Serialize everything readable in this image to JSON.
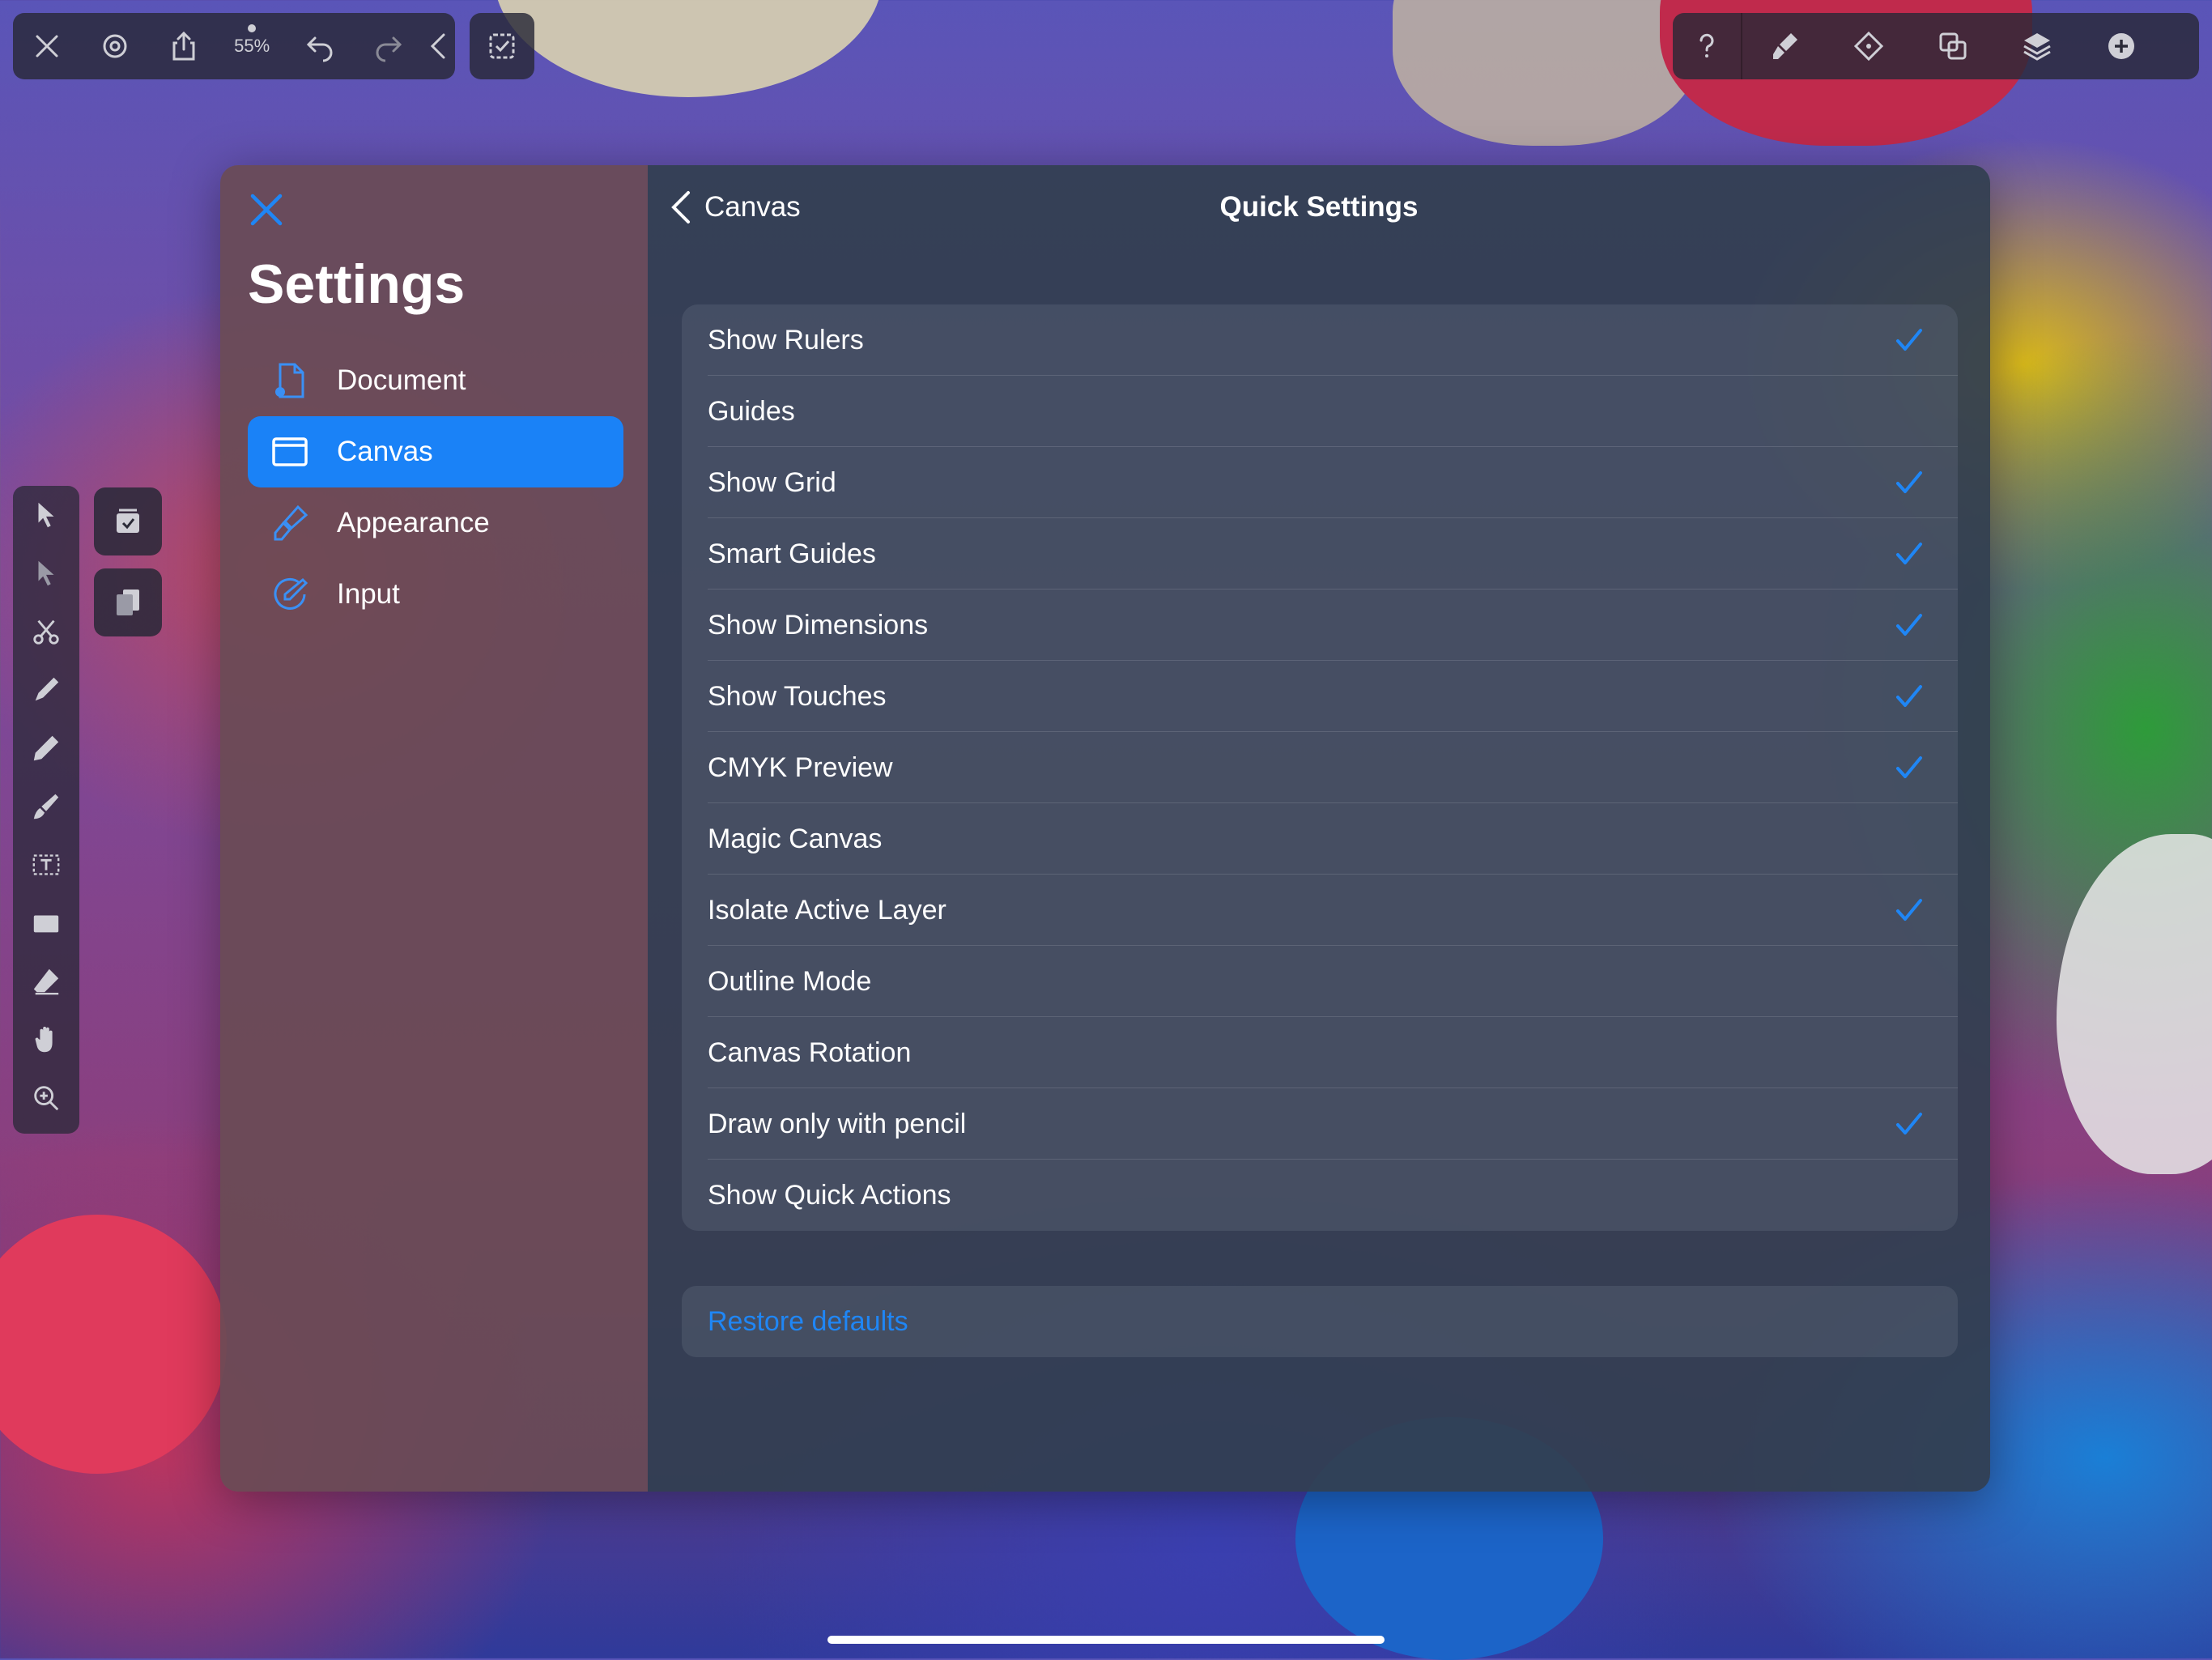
{
  "toolbar": {
    "zoom_label": "55%"
  },
  "settings": {
    "title": "Settings",
    "nav": [
      {
        "label": "Document",
        "icon": "document-gear-icon",
        "active": false
      },
      {
        "label": "Canvas",
        "icon": "canvas-window-icon",
        "active": true
      },
      {
        "label": "Appearance",
        "icon": "paintbrush-icon",
        "active": false
      },
      {
        "label": "Input",
        "icon": "pencil-circle-icon",
        "active": false
      }
    ]
  },
  "panel": {
    "back_label": "Canvas",
    "title": "Quick Settings",
    "options": [
      {
        "label": "Show Rulers",
        "checked": true
      },
      {
        "label": "Guides",
        "checked": false
      },
      {
        "label": "Show Grid",
        "checked": true
      },
      {
        "label": "Smart Guides",
        "checked": true
      },
      {
        "label": "Show Dimensions",
        "checked": true
      },
      {
        "label": "Show Touches",
        "checked": true
      },
      {
        "label": "CMYK Preview",
        "checked": true
      },
      {
        "label": "Magic Canvas",
        "checked": false
      },
      {
        "label": "Isolate Active Layer",
        "checked": true
      },
      {
        "label": "Outline Mode",
        "checked": false
      },
      {
        "label": "Canvas Rotation",
        "checked": false
      },
      {
        "label": "Draw only with pencil",
        "checked": true
      },
      {
        "label": "Show Quick Actions",
        "checked": false
      }
    ],
    "restore_label": "Restore defaults"
  },
  "colors": {
    "accent": "#1a82f7",
    "checkmark": "#1f86f5"
  }
}
